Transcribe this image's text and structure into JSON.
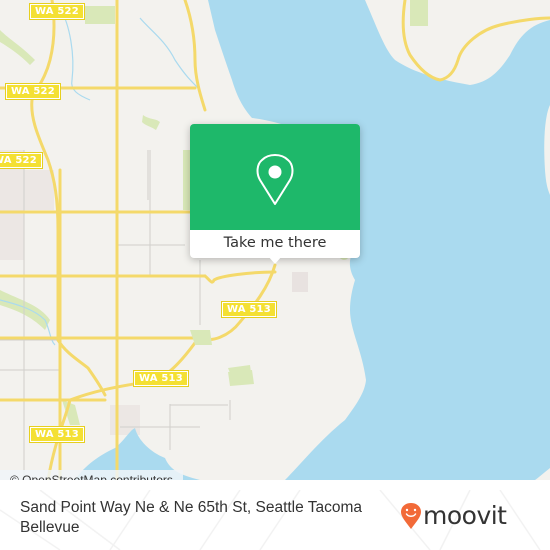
{
  "map": {
    "colors": {
      "land": "#f3f2ee",
      "water": "#aadaef",
      "park": "#d9e8b8",
      "road_major": "#f7e26b",
      "road_minor": "#d0cfcb"
    },
    "road_shields": [
      {
        "label": "WA 522"
      },
      {
        "label": "WA 522"
      },
      {
        "label": "WA 522"
      },
      {
        "label": "WA 513"
      },
      {
        "label": "WA 513"
      },
      {
        "label": "WA 513"
      }
    ],
    "attribution": "© OpenStreetMap contributors"
  },
  "popup": {
    "icon": "map-pin-icon",
    "button_label": "Take me there",
    "color": "#1eb86a"
  },
  "footer": {
    "address": "Sand Point Way Ne & Ne 65th St, Seattle Tacoma Bellevue",
    "brand": {
      "name": "moovit",
      "icon": "moovit-pin-icon",
      "color": "#f26a38"
    }
  }
}
